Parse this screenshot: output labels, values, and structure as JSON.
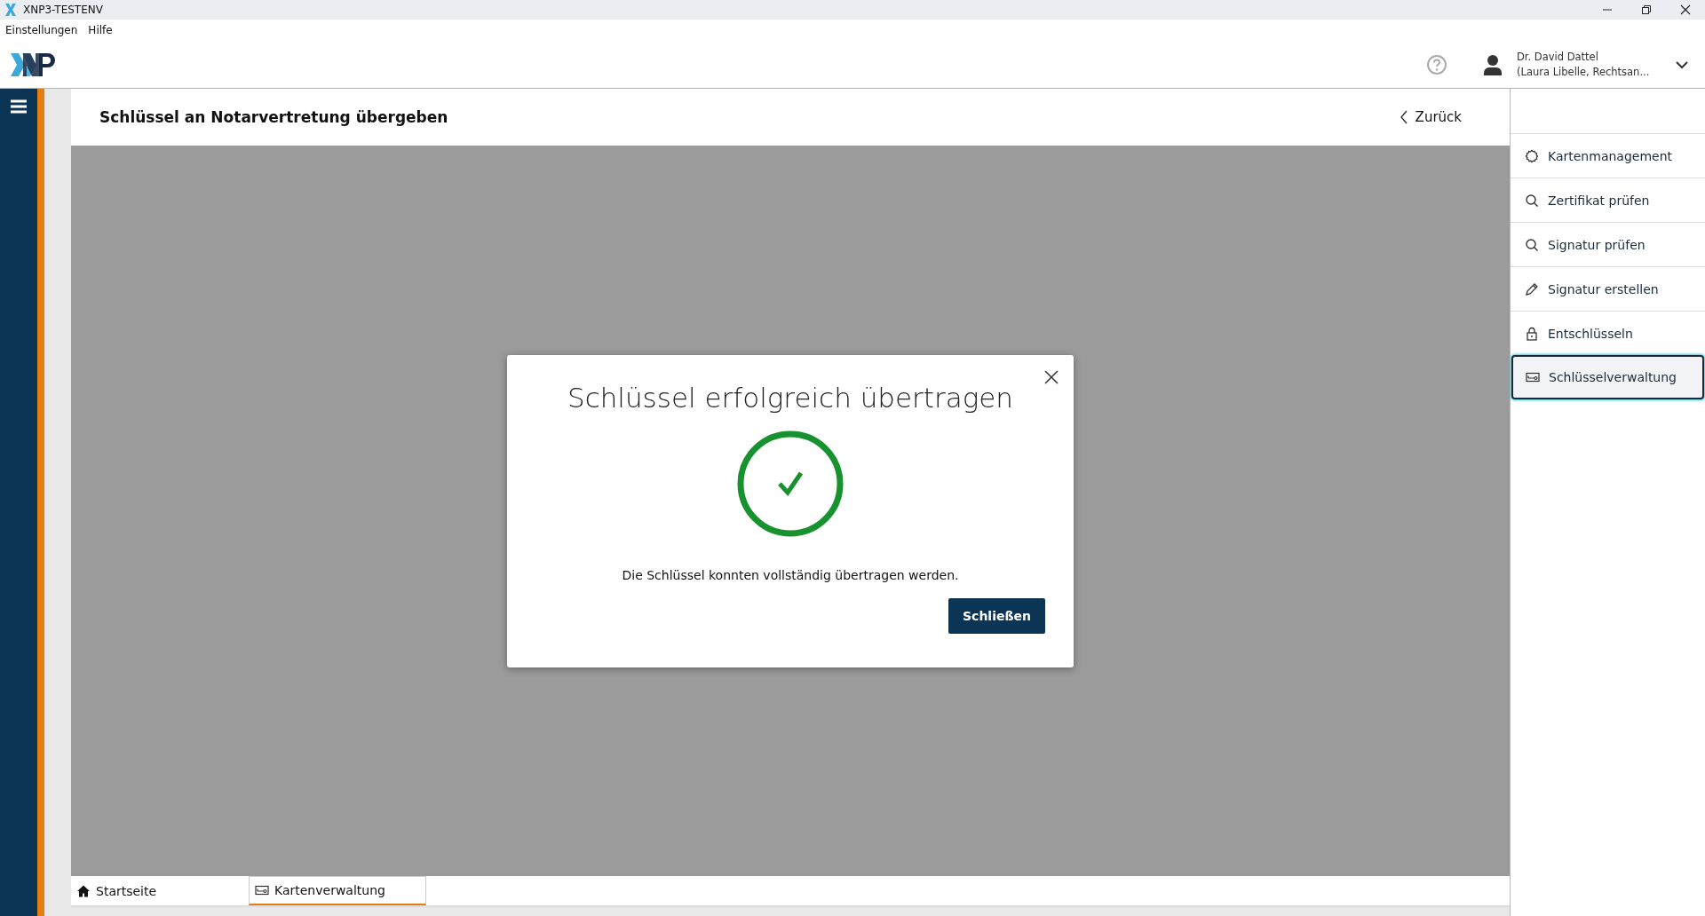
{
  "window": {
    "title": "XNP3-TESTENV"
  },
  "menu": [
    "Einstellungen",
    "Hilfe"
  ],
  "user": {
    "name": "Dr. David Dattel",
    "role": "(Laura Libelle, Rechtsan..."
  },
  "page": {
    "title": "Schlüssel an Notarvertretung übergeben",
    "back": "Zurück"
  },
  "dialog": {
    "title": "Schlüssel erfolgreich übertragen",
    "message": "Die Schlüssel konnten vollständig übertragen werden.",
    "button": "Schließen"
  },
  "actions": [
    {
      "label": "Kartenmanagement",
      "kind": "gear",
      "selected": false
    },
    {
      "label": "Zertifikat prüfen",
      "kind": "search",
      "selected": false
    },
    {
      "label": "Signatur prüfen",
      "kind": "search",
      "selected": false
    },
    {
      "label": "Signatur erstellen",
      "kind": "pencil",
      "selected": false
    },
    {
      "label": "Entschlüsseln",
      "kind": "lock",
      "selected": false
    },
    {
      "label": "Schlüsselverwaltung",
      "kind": "key",
      "selected": true
    }
  ],
  "tabs": [
    {
      "label": "Startseite",
      "kind": "home",
      "selected": false
    },
    {
      "label": "Kartenverwaltung",
      "kind": "key",
      "selected": true
    }
  ]
}
